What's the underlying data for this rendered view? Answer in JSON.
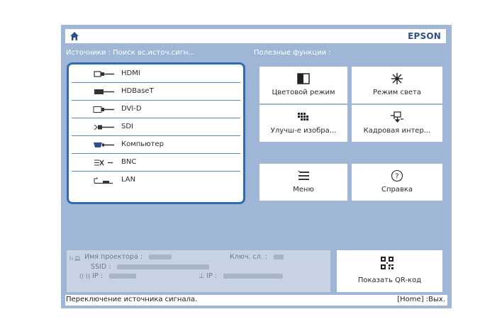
{
  "header": {
    "brand": "EPSON",
    "home_icon": "home-icon"
  },
  "sources": {
    "label": "Источники : Поиск вс.источ.сигн...",
    "items": [
      {
        "label": "HDMI",
        "icon": "hdmi-port-icon"
      },
      {
        "label": "HDBaseT",
        "icon": "hdbaset-port-icon"
      },
      {
        "label": "DVI-D",
        "icon": "dvi-port-icon"
      },
      {
        "label": "SDI",
        "icon": "sdi-port-icon"
      },
      {
        "label": "Компьютер",
        "icon": "computer-port-icon"
      },
      {
        "label": "BNC",
        "icon": "bnc-port-icon"
      },
      {
        "label": "LAN",
        "icon": "lan-port-icon"
      }
    ]
  },
  "functions": {
    "label": "Полезные функции :",
    "items": [
      {
        "label": "Цветовой режим",
        "icon": "color-mode-icon"
      },
      {
        "label": "Режим света",
        "icon": "light-mode-icon"
      },
      {
        "label": "Улучш-е изобра...",
        "icon": "image-enhance-icon"
      },
      {
        "label": "Кадровая интер...",
        "icon": "frame-interpolation-icon"
      },
      {
        "label": "Меню",
        "icon": "menu-icon"
      },
      {
        "label": "Справка",
        "icon": "help-icon"
      }
    ]
  },
  "info": {
    "projector_name_label": "Имя проектора :",
    "keyword_label": "Ключ. сл. :",
    "ssid_label": "SSID :",
    "wireless_ip_label": "IP :",
    "wired_ip_label": "IP :"
  },
  "qr": {
    "label": "Показать QR-код",
    "icon": "qr-code-icon"
  },
  "status": {
    "left": "Переключение источника сигнала.",
    "right": "[Home] :Вых."
  }
}
